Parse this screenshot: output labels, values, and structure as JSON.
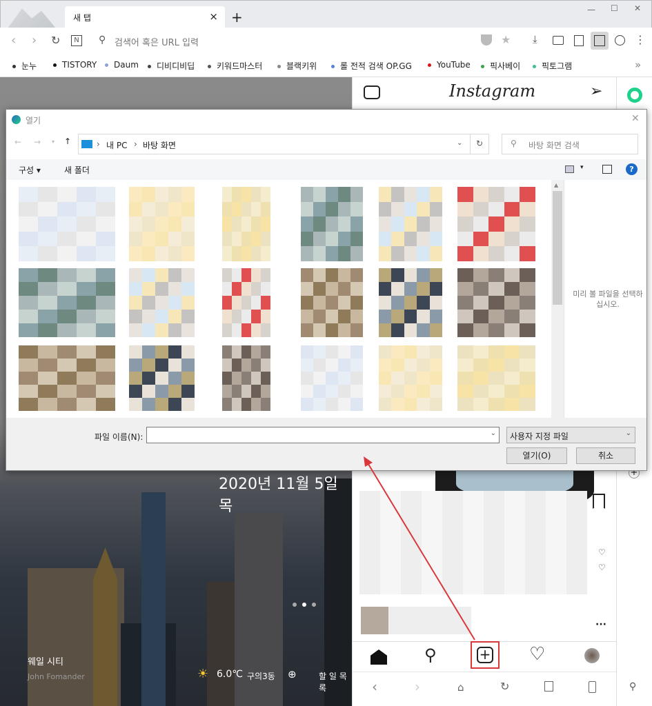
{
  "browser": {
    "tab_title": "새 탭",
    "close_tab": "×",
    "new_tab": "+",
    "win_min": "—",
    "win_max": "☐",
    "win_close": "✕",
    "address_placeholder": "검색어 혹은 URL 입력",
    "bookmarks": [
      {
        "label": "눈누",
        "color": "#333333"
      },
      {
        "label": "TISTORY",
        "color": "#111111"
      },
      {
        "label": "Daum",
        "color": "#8fa0d8"
      },
      {
        "label": "디비디비딥",
        "color": "#444444"
      },
      {
        "label": "키워드마스터",
        "color": "#555555"
      },
      {
        "label": "블랙키위",
        "color": "#888888"
      },
      {
        "label": "롤 전적 검색 OP.GG",
        "color": "#5a7fd8"
      },
      {
        "label": "YouTube",
        "color": "#e01010"
      },
      {
        "label": "픽사베이",
        "color": "#3aa34a"
      },
      {
        "label": "픽토그램",
        "color": "#3cc08c"
      }
    ],
    "more": "»"
  },
  "newtab": {
    "date": "2020년 11월 5일 목",
    "city": "웨일 시티",
    "photographer": "John Fomander",
    "temperature": "6.0℃",
    "location": "구의3동",
    "todo": "할 일 목록"
  },
  "instagram": {
    "logo": "Instagram"
  },
  "dialog": {
    "title": "열기",
    "path": [
      "내 PC",
      "바탕 화면"
    ],
    "search_placeholder": "바탕 화면 검색",
    "organize": "구성 ▾",
    "new_folder": "새 폴더",
    "preview_text": "미리 볼 파일을 선택하십시오.",
    "filename_label": "파일 이름(N):",
    "filename_value": "",
    "filetype": "사용자 지정 파일",
    "open": "열기(O)",
    "cancel": "취소",
    "help": "?"
  },
  "colors": {
    "accent": "#d9373a",
    "whale_green": "#1fd18b"
  }
}
